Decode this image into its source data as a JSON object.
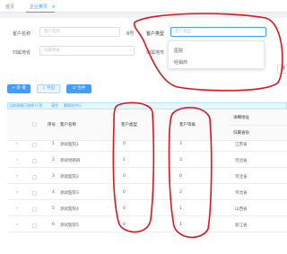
{
  "tabs": [
    {
      "label": "首页"
    },
    {
      "label": "企业黄页"
    }
  ],
  "filters": {
    "customer_name": {
      "label": "客户名称",
      "placeholder": "客户名称"
    },
    "customer_type": {
      "label": "客户类型",
      "placeholder": "客户类型"
    },
    "region": {
      "label": "归属地省",
      "placeholder": "归属地省"
    },
    "city_label": "归属地市",
    "partial_label": "B号",
    "reset_label": "重"
  },
  "dropdown": {
    "options": [
      "医院",
      "经销商"
    ]
  },
  "toolbar": {
    "add_label": "+ 新 增",
    "export_label": "导出",
    "merge_label": "合并"
  },
  "selection": {
    "text": "当前表格已选择 0 项",
    "clear": "清空",
    "delete": "删除选中行"
  },
  "table": {
    "headers": {
      "seq": "序号",
      "name": "客户名称",
      "type": "客户类型",
      "level": "客户等级",
      "detail_group": "详细地址",
      "province": "归属省份"
    },
    "rows": [
      {
        "seq": "1",
        "name": "测试医院1",
        "type": "0",
        "level": "3",
        "province": "江苏省"
      },
      {
        "seq": "2",
        "name": "测试经销商",
        "type": "1",
        "level": "3",
        "province": "河北省"
      },
      {
        "seq": "3",
        "name": "测试医院2",
        "type": "0",
        "level": "0",
        "province": "河北省"
      },
      {
        "seq": "4",
        "name": "测试医院3",
        "type": "0",
        "level": "2",
        "province": "河北省"
      },
      {
        "seq": "5",
        "name": "测试医院4",
        "type": "0",
        "level": "1",
        "province": "山西省"
      },
      {
        "seq": "6",
        "name": "测试医院5",
        "type": "0",
        "level": "1",
        "province": "浙江省"
      }
    ]
  },
  "colors": {
    "primary": "#409eff",
    "annotation": "#e0141e"
  }
}
